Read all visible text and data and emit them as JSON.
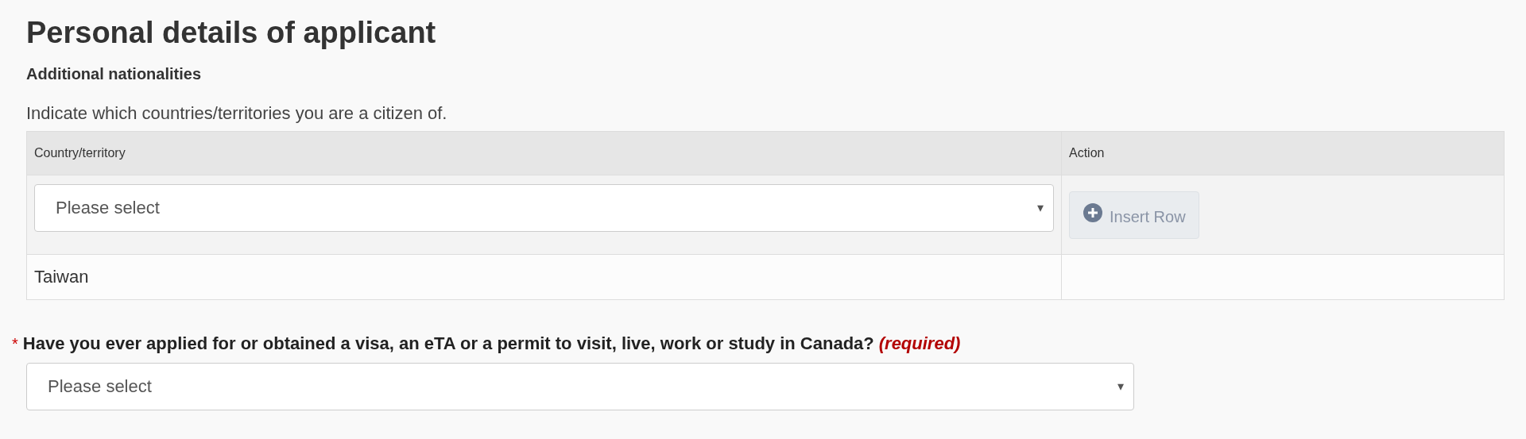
{
  "heading": "Personal details of applicant",
  "section": {
    "title": "Additional nationalities",
    "instruction": "Indicate which countries/territories you are a citizen of.",
    "table": {
      "columns": [
        "Country/territory",
        "Action"
      ],
      "entry_row": {
        "select": {
          "placeholder": "Please select",
          "arrow": "▾"
        },
        "button": {
          "label": "Insert Row",
          "disabled": true
        }
      },
      "rows": [
        {
          "country": "Taiwan"
        }
      ]
    }
  },
  "question": {
    "marker": "*",
    "label": "Have you ever applied for or obtained a visa, an eTA or a permit to visit, live, work or study in Canada?",
    "required_note": "(required)",
    "select": {
      "placeholder": "Please select",
      "arrow": "▾"
    }
  }
}
